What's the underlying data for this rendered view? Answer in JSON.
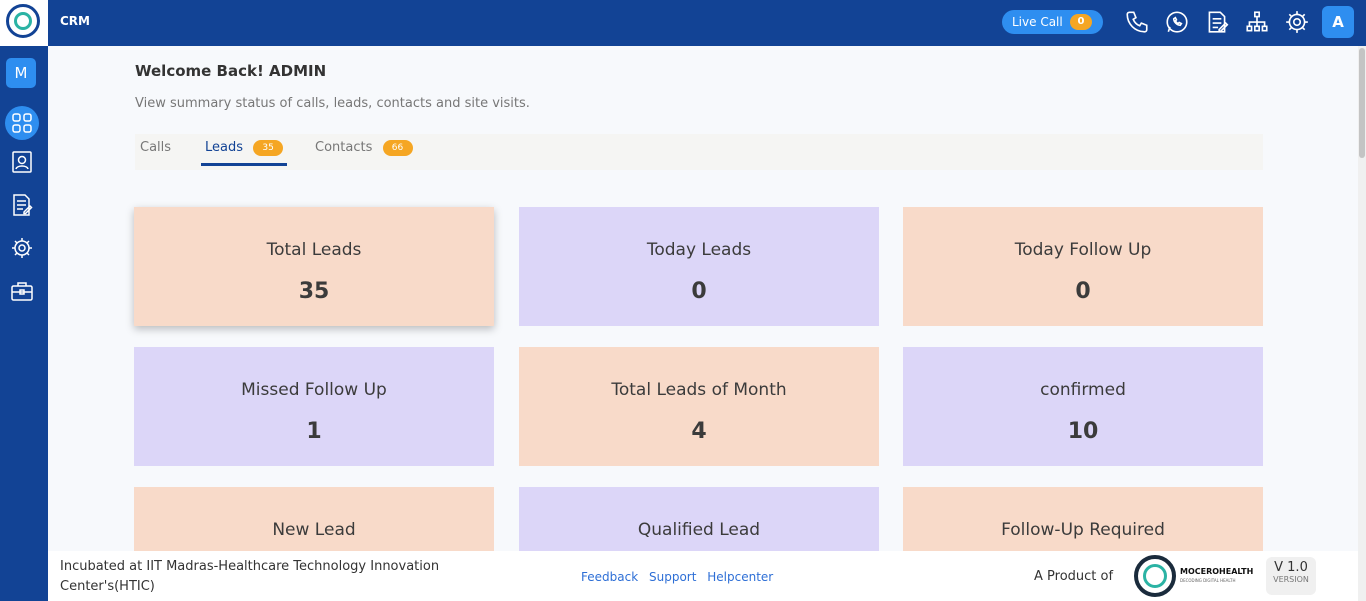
{
  "header": {
    "app_title": "CRM",
    "live_call_label": "Live Call",
    "live_call_count": "0",
    "avatar_initial": "A",
    "icons": [
      "phone-icon",
      "whatsapp-icon",
      "notes-icon",
      "sitemap-icon",
      "gear-icon"
    ]
  },
  "sidebar": {
    "initial": "M",
    "items": [
      "dashboard-icon",
      "contact-card-icon",
      "notes-icon",
      "gear-icon",
      "briefcase-icon"
    ]
  },
  "main": {
    "welcome": "Welcome Back! ADMIN",
    "subtitle": "View summary status of calls, leads, contacts and site visits.",
    "tabs": [
      {
        "label": "Calls",
        "badge": ""
      },
      {
        "label": "Leads",
        "badge": "35"
      },
      {
        "label": "Contacts",
        "badge": "66"
      }
    ],
    "cards": [
      {
        "label": "Total Leads",
        "value": "35"
      },
      {
        "label": "Today Leads",
        "value": "0"
      },
      {
        "label": "Today Follow Up",
        "value": "0"
      },
      {
        "label": "Missed Follow Up",
        "value": "1"
      },
      {
        "label": "Total Leads of Month",
        "value": "4"
      },
      {
        "label": "confirmed",
        "value": "10"
      },
      {
        "label": "New Lead",
        "value": ""
      },
      {
        "label": "Qualified Lead",
        "value": ""
      },
      {
        "label": "Follow-Up Required",
        "value": ""
      }
    ]
  },
  "footer": {
    "incubated": "Incubated at IIT Madras-Healthcare Technology Innovation Center's(HTIC)",
    "links": [
      "Feedback",
      "Support",
      "Helpcenter"
    ],
    "product_of": "A Product of",
    "brand_name": "MOCEROHEALTH",
    "brand_tagline": "DECODING DIGITAL HEALTH",
    "version": "V 1.0",
    "version_label": "VERSION"
  },
  "colors": {
    "primary": "#124395",
    "accent": "#2e8ef0",
    "badge": "#f5a623",
    "card_peach": "#f8dac9",
    "card_lavender": "#dcd6f8"
  }
}
